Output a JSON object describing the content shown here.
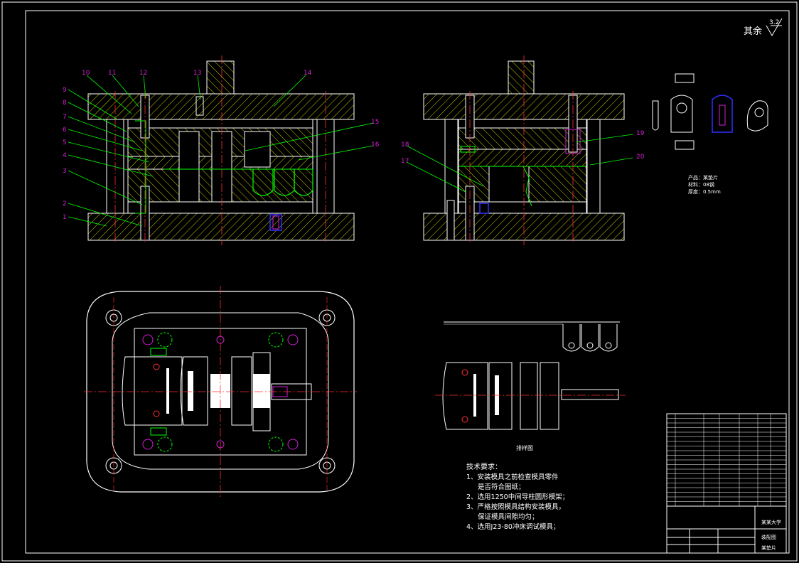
{
  "colors": {
    "background": "#000000",
    "frame": "#ffffff",
    "outline": "#ffffff",
    "center_line": "#ff3030",
    "hatch": "#ffff00",
    "part": "#00ff00",
    "leader": "#00ff00",
    "balloon_text": "#d020d0",
    "hidden": "#ffff00",
    "screw": "#d020d0",
    "blue_part": "#3030ff"
  },
  "roughness_symbol": {
    "label": "其余",
    "value": "3.2"
  },
  "front_view_balloons": [
    "1",
    "2",
    "3",
    "4",
    "5",
    "6",
    "7",
    "8",
    "9",
    "10",
    "11",
    "12",
    "13",
    "14",
    "15",
    "16"
  ],
  "side_view_balloons": [
    "17",
    "18",
    "19",
    "20"
  ],
  "product_info": {
    "name": "产品：某垫片",
    "material": "材料：08钢",
    "thickness": "厚度：0.5mm"
  },
  "strip_layout_caption": "排样图",
  "tech_requirements": {
    "title": "技术要求：",
    "items": [
      "1、安装模具之前检查模具零件",
      "是否符合图纸；",
      "2、选用1250中间导柱圆形模架；",
      "3、严格按照模具结构安装模具，",
      "保证模具间隙均匀；",
      "4、选用J23-80冲床调试模具；"
    ]
  },
  "title_block": {
    "drawing_name": "装配图",
    "product": "某垫片",
    "school": "某某大学",
    "part_list_rows": 20
  }
}
